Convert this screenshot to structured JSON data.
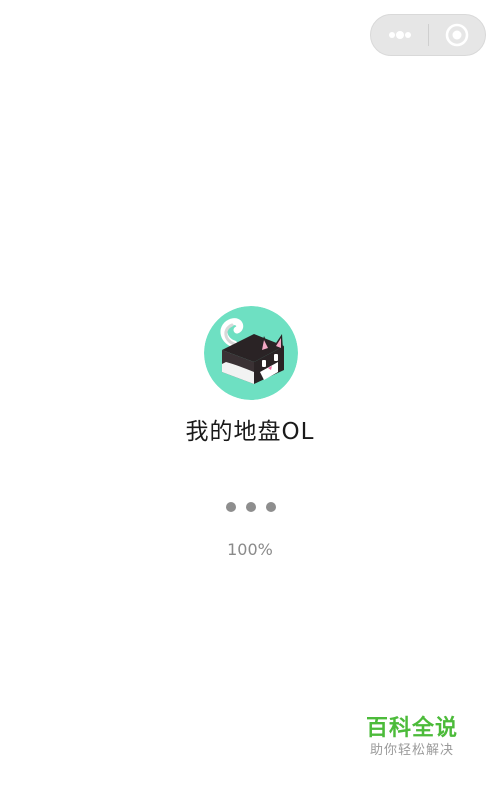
{
  "capsule": {
    "more_icon": "more-dots-icon",
    "close_icon": "close-target-icon"
  },
  "app": {
    "icon": "husky-cube-logo-icon",
    "name": "我的地盘OL"
  },
  "loading": {
    "progress_text": "100%",
    "progress_value": 100
  },
  "watermark": {
    "title": "百科全说",
    "subtitle": "助你轻松解决"
  },
  "colors": {
    "icon_bg": "#6ee0c2",
    "watermark_green": "#4cbb3a",
    "dots_gray": "#8e8e8e",
    "capsule_bg": "#e6e6e6"
  }
}
